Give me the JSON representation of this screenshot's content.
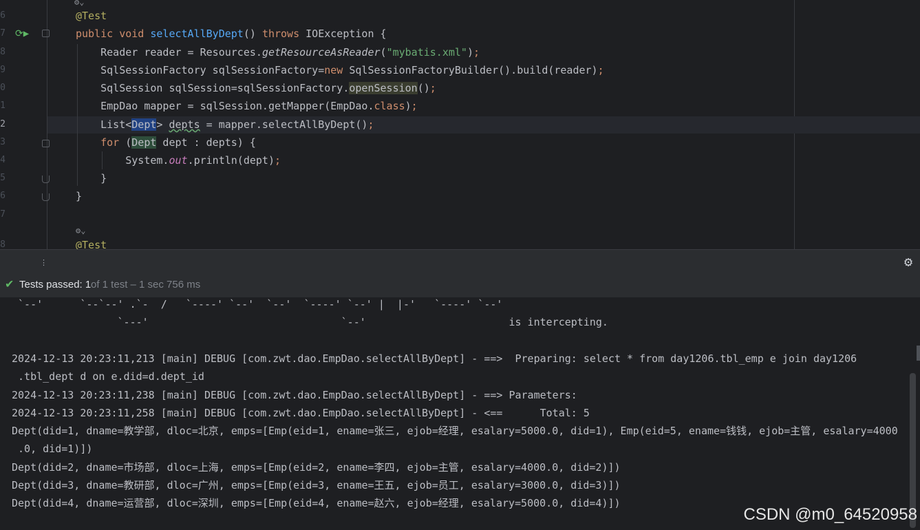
{
  "editor": {
    "lines": [
      {
        "num": "6",
        "code_parts": [
          {
            "t": "@Test",
            "c": "ann"
          }
        ]
      },
      {
        "num": "7",
        "code_parts": [
          {
            "t": "public ",
            "c": "kw"
          },
          {
            "t": "void ",
            "c": "kw"
          },
          {
            "t": "selectAllByDept",
            "c": "fn"
          },
          {
            "t": "() ",
            "c": ""
          },
          {
            "t": "throws ",
            "c": "kw"
          },
          {
            "t": "IOException {",
            "c": ""
          }
        ]
      },
      {
        "num": "8",
        "code_parts": [
          {
            "t": "    Reader reader = Resources.",
            "c": ""
          },
          {
            "t": "getResourceAsReader",
            "c": "static-m"
          },
          {
            "t": "(",
            "c": ""
          },
          {
            "t": "\"mybatis.xml\"",
            "c": "str"
          },
          {
            "t": ")",
            "c": ""
          },
          {
            "t": ";",
            "c": "kw"
          }
        ]
      },
      {
        "num": "9",
        "code_parts": [
          {
            "t": "    SqlSessionFactory sqlSessionFactory=",
            "c": ""
          },
          {
            "t": "new ",
            "c": "kw"
          },
          {
            "t": "SqlSessionFactoryBuilder().build(reader)",
            "c": ""
          },
          {
            "t": ";",
            "c": "kw"
          }
        ]
      },
      {
        "num": "0",
        "code_parts": [
          {
            "t": "    SqlSession sqlSession=sqlSessionFactory.",
            "c": ""
          },
          {
            "t": "openSession",
            "c": "hl-bg"
          },
          {
            "t": "()",
            "c": ""
          },
          {
            "t": ";",
            "c": "kw"
          }
        ]
      },
      {
        "num": "1",
        "code_parts": [
          {
            "t": "    EmpDao mapper = sqlSession.getMapper(EmpDao.",
            "c": ""
          },
          {
            "t": "class",
            "c": "kw"
          },
          {
            "t": ")",
            "c": ""
          },
          {
            "t": ";",
            "c": "kw"
          }
        ]
      },
      {
        "num": "2",
        "code_parts": [
          {
            "t": "    List<",
            "c": ""
          },
          {
            "t": "Dept",
            "c": "sel"
          },
          {
            "t": "> ",
            "c": ""
          },
          {
            "t": "depts",
            "c": "wavy"
          },
          {
            "t": " = mapper.selectAllByDept()",
            "c": ""
          },
          {
            "t": ";",
            "c": "kw"
          }
        ]
      },
      {
        "num": "3",
        "code_parts": [
          {
            "t": "    ",
            "c": ""
          },
          {
            "t": "for ",
            "c": "kw"
          },
          {
            "t": "(",
            "c": ""
          },
          {
            "t": "Dept",
            "c": "typ-hl"
          },
          {
            "t": " dept : depts) {",
            "c": ""
          }
        ]
      },
      {
        "num": "4",
        "code_parts": [
          {
            "t": "        System.",
            "c": ""
          },
          {
            "t": "out",
            "c": "it"
          },
          {
            "t": ".println(dept)",
            "c": ""
          },
          {
            "t": ";",
            "c": "kw"
          }
        ]
      },
      {
        "num": "5",
        "code_parts": [
          {
            "t": "    }",
            "c": ""
          }
        ]
      },
      {
        "num": "6",
        "code_parts": [
          {
            "t": "}",
            "c": ""
          }
        ]
      },
      {
        "num": "7",
        "code_parts": []
      },
      {
        "num": "",
        "code_parts": [
          {
            "t": "⚙︎⌄",
            "c": "gear"
          }
        ]
      },
      {
        "num": "8",
        "code_parts": [
          {
            "t": "@Test",
            "c": "ann"
          }
        ]
      }
    ]
  },
  "run_panel": {
    "status_label": "Tests passed: 1",
    "status_detail": " of 1 test – 1 sec 756 ms",
    "handle": "⋮",
    "settings_icon": "settings-gear-icon"
  },
  "console": {
    "lines": [
      " `--'      `--`--' .`-  /   `----' `--'  `--'  `----' `--' |  |-'   `----' `--'",
      "                 `---'                               `--'                       is intercepting.",
      "",
      "2024-12-13 20:23:11,213 [main] DEBUG [com.zwt.dao.EmpDao.selectAllByDept] - ==>  Preparing: select * from day1206.tbl_emp e join day1206",
      " .tbl_dept d on e.did=d.dept_id",
      "2024-12-13 20:23:11,238 [main] DEBUG [com.zwt.dao.EmpDao.selectAllByDept] - ==> Parameters: ",
      "2024-12-13 20:23:11,258 [main] DEBUG [com.zwt.dao.EmpDao.selectAllByDept] - <==      Total: 5",
      "Dept(did=1, dname=教学部, dloc=北京, emps=[Emp(eid=1, ename=张三, ejob=经理, esalary=5000.0, did=1), Emp(eid=5, ename=钱钱, ejob=主管, esalary=4000",
      " .0, did=1)])",
      "Dept(did=2, dname=市场部, dloc=上海, emps=[Emp(eid=2, ename=李四, ejob=主管, esalary=4000.0, did=2)])",
      "Dept(did=3, dname=教研部, dloc=广州, emps=[Emp(eid=3, ename=王五, ejob=员工, esalary=3000.0, did=3)])",
      "Dept(did=4, dname=运营部, dloc=深圳, emps=[Emp(eid=4, ename=赵六, ejob=经理, esalary=5000.0, did=4)])"
    ]
  },
  "watermark": "CSDN @m0_64520958"
}
